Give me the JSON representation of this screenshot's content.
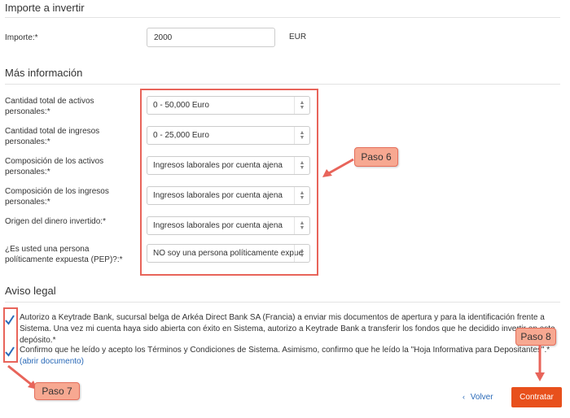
{
  "investment": {
    "title": "Importe a invertir",
    "amount_label": "Importe:*",
    "amount_value": "2000",
    "currency": "EUR"
  },
  "more_info": {
    "title": "Más información",
    "fields": [
      {
        "label": "Cantidad total de activos personales:*",
        "value": "0 - 50,000 Euro"
      },
      {
        "label": "Cantidad total de ingresos personales:*",
        "value": "0 - 25,000 Euro"
      },
      {
        "label": "Composición de los activos personales:*",
        "value": "Ingresos laborales por cuenta ajena"
      },
      {
        "label": "Composición de los ingresos personales:*",
        "value": "Ingresos laborales por cuenta ajena"
      },
      {
        "label": "Origen del dinero invertido:*",
        "value": "Ingresos laborales por cuenta ajena"
      },
      {
        "label": "¿Es usted una persona políticamente expuesta (PEP)?:*",
        "value": "NO soy una persona políticamente expue"
      }
    ]
  },
  "legal": {
    "title": "Aviso legal",
    "consent_1": "Autorizo a Keytrade Bank, sucursal belga de Arkéa Direct Bank SA (Francia) a enviar mis documentos de apertura y para la identificación frente a Sistema. Una vez mi cuenta haya sido abierta con éxito en Sistema, autorizo a Keytrade Bank a transferir los fondos que he decidido invertir en este depósito.*",
    "consent_2": "Confirmo que he leído y acepto los Términos y Condiciones de Sistema. Asimismo, confirmo que he leído la \"Hoja Informativa para Depositantes\".*",
    "consent_2_link": "(abrir documento)"
  },
  "actions": {
    "back": "Volver",
    "submit": "Contratar"
  },
  "annotations": {
    "step6": "Paso 6",
    "step7": "Paso 7",
    "step8": "Paso 8"
  },
  "colors": {
    "accent": "#e8501c",
    "annotation": "#e8645a",
    "link": "#2a6ab8"
  }
}
